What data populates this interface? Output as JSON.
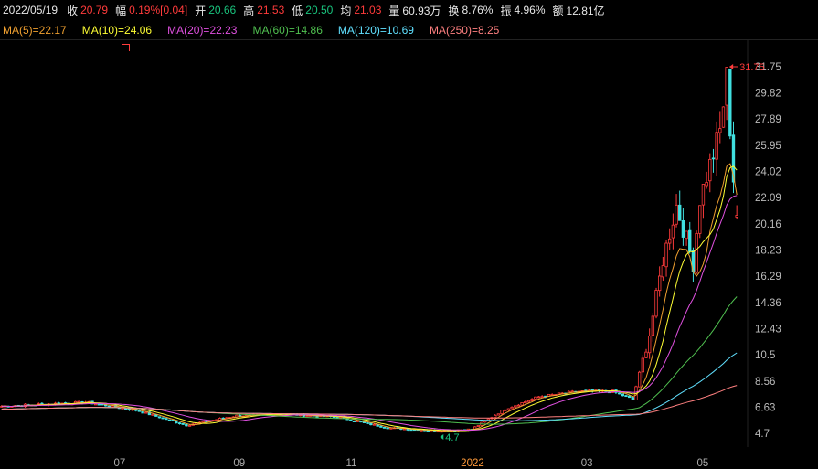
{
  "info": {
    "date": "2022/05/19",
    "close_label": "收",
    "close": "20.79",
    "chg_label": "幅",
    "chg": "0.19%[0.04]",
    "open_label": "开",
    "open": "20.66",
    "high_label": "高",
    "high": "21.53",
    "low_label": "低",
    "low": "20.50",
    "avg_label": "均",
    "avg": "21.03",
    "vol_label": "量",
    "vol": "60.93万",
    "turnover_label": "换",
    "turnover": "8.76%",
    "amp_label": "振",
    "amp": "4.96%",
    "amount_label": "额",
    "amount": "12.81亿"
  },
  "ma": [
    {
      "text": "MA(5)=22.17",
      "color": "#f0a030"
    },
    {
      "text": "MA(10)=24.06",
      "color": "#ffff33"
    },
    {
      "text": "MA(20)=22.23",
      "color": "#e050e0"
    },
    {
      "text": "MA(60)=14.86",
      "color": "#50c050"
    },
    {
      "text": "MA(120)=10.69",
      "color": "#60e0ff"
    },
    {
      "text": "MA(250)=8.25",
      "color": "#ff8080"
    }
  ],
  "chart_data": {
    "type": "candlestick",
    "y_ticks": [
      "31.75",
      "29.82",
      "27.89",
      "25.95",
      "24.02",
      "22.09",
      "20.16",
      "18.23",
      "16.29",
      "14.36",
      "12.43",
      "10.5",
      "8.56",
      "6.63",
      "4.7"
    ],
    "ylim": [
      4.7,
      31.75
    ],
    "x_ticks": [
      {
        "label": "07",
        "pos": 0.16,
        "color": "#aaaaaa"
      },
      {
        "label": "09",
        "pos": 0.32,
        "color": "#aaaaaa"
      },
      {
        "label": "11",
        "pos": 0.47,
        "color": "#aaaaaa"
      },
      {
        "label": "2022",
        "pos": 0.632,
        "color": "#ff9a3a"
      },
      {
        "label": "03",
        "pos": 0.785,
        "color": "#aaaaaa"
      },
      {
        "label": "05",
        "pos": 0.94,
        "color": "#aaaaaa"
      }
    ],
    "annotations": [
      {
        "text": "31.75",
        "value": 31.75,
        "type": "high",
        "color": "#ff3b3b"
      },
      {
        "text": "4.7",
        "value": 4.7,
        "type": "low",
        "color": "#19c37d"
      }
    ],
    "ma_last": {
      "MA5": 22.17,
      "MA10": 24.06,
      "MA20": 22.23,
      "MA60": 14.86,
      "MA120": 10.69,
      "MA250": 8.25
    },
    "last_candle": {
      "open": 20.66,
      "high": 21.53,
      "low": 20.5,
      "close": 20.79
    },
    "up_color": "#ff3b3b",
    "down_color": "#40e0e0",
    "grid": false
  }
}
